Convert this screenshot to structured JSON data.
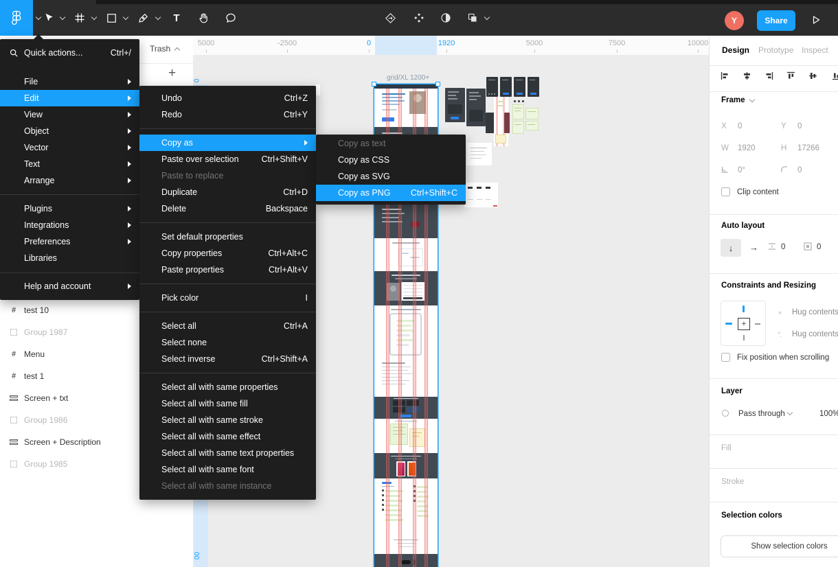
{
  "toolbar": {
    "share": "Share",
    "avatar": "Y",
    "accent": "#18a0fb",
    "avatar_color": "#ef6f61"
  },
  "menus": {
    "quick": {
      "label": "Quick actions...",
      "shortcut": "Ctrl+/"
    },
    "main_items": [
      {
        "label": "File"
      },
      {
        "label": "Edit"
      },
      {
        "label": "View"
      },
      {
        "label": "Object"
      },
      {
        "label": "Vector"
      },
      {
        "label": "Text"
      },
      {
        "label": "Arrange"
      },
      {
        "label": "Plugins"
      },
      {
        "label": "Integrations"
      },
      {
        "label": "Preferences"
      },
      {
        "label": "Libraries"
      },
      {
        "label": "Help and account"
      }
    ],
    "edit_items": [
      {
        "label": "Undo",
        "shortcut": "Ctrl+Z"
      },
      {
        "label": "Redo",
        "shortcut": "Ctrl+Y"
      },
      {
        "label": "Copy as"
      },
      {
        "label": "Paste over selection",
        "shortcut": "Ctrl+Shift+V"
      },
      {
        "label": "Paste to replace"
      },
      {
        "label": "Duplicate",
        "shortcut": "Ctrl+D"
      },
      {
        "label": "Delete",
        "shortcut": "Backspace"
      },
      {
        "label": "Set default properties"
      },
      {
        "label": "Copy properties",
        "shortcut": "Ctrl+Alt+C"
      },
      {
        "label": "Paste properties",
        "shortcut": "Ctrl+Alt+V"
      },
      {
        "label": "Pick color",
        "shortcut": "I"
      },
      {
        "label": "Select all",
        "shortcut": "Ctrl+A"
      },
      {
        "label": "Select none"
      },
      {
        "label": "Select inverse",
        "shortcut": "Ctrl+Shift+A"
      },
      {
        "label": "Select all with same properties"
      },
      {
        "label": "Select all with same fill"
      },
      {
        "label": "Select all with same stroke"
      },
      {
        "label": "Select all with same effect"
      },
      {
        "label": "Select all with same text properties"
      },
      {
        "label": "Select all with same font"
      },
      {
        "label": "Select all with same instance"
      }
    ],
    "copy_items": [
      {
        "label": "Copy as text"
      },
      {
        "label": "Copy as CSS"
      },
      {
        "label": "Copy as SVG"
      },
      {
        "label": "Copy as PNG",
        "shortcut": "Ctrl+Shift+C"
      }
    ]
  },
  "pages": {
    "trash": "Trash",
    "add": "+"
  },
  "layers": [
    {
      "label": "test 10"
    },
    {
      "label": "Group 1987"
    },
    {
      "label": "Menu"
    },
    {
      "label": "test 1"
    },
    {
      "label": "Screen + txt"
    },
    {
      "label": "Group 1986"
    },
    {
      "label": "Screen + Description"
    },
    {
      "label": "Group 1985"
    }
  ],
  "ruler": {
    "labels": [
      {
        "text": "5000"
      },
      {
        "text": "-2500"
      },
      {
        "text": "0"
      },
      {
        "text": "1920"
      },
      {
        "text": "5000"
      },
      {
        "text": "7500"
      },
      {
        "text": "10000"
      }
    ],
    "v_top": "0",
    "v_bottom": "00"
  },
  "canvas": {
    "frame_label": "grid/XL 1200+"
  },
  "insp": {
    "tab_design": "Design",
    "tab_prototype": "Prototype",
    "tab_inspect": "Inspect",
    "frame_title": "Frame",
    "x": "X",
    "x_val": "0",
    "y": "Y",
    "y_val": "0",
    "w": "W",
    "w_val": "1920",
    "h": "H",
    "h_val": "17266",
    "rot_val": "0°",
    "rad_val": "0",
    "clip": "Clip content",
    "auto_title": "Auto layout",
    "gap_val": "0",
    "pad_val": "0",
    "constraints_title": "Constraints and Resizing",
    "hug_h": "Hug contents",
    "hug_v": "Hug contents",
    "fix": "Fix position when scrolling",
    "layer_title": "Layer",
    "blend": "Pass through",
    "opacity": "100%",
    "fill_title": "Fill",
    "stroke_title": "Stroke",
    "selcolors_title": "Selection colors",
    "show_btn": "Show selection colors"
  }
}
